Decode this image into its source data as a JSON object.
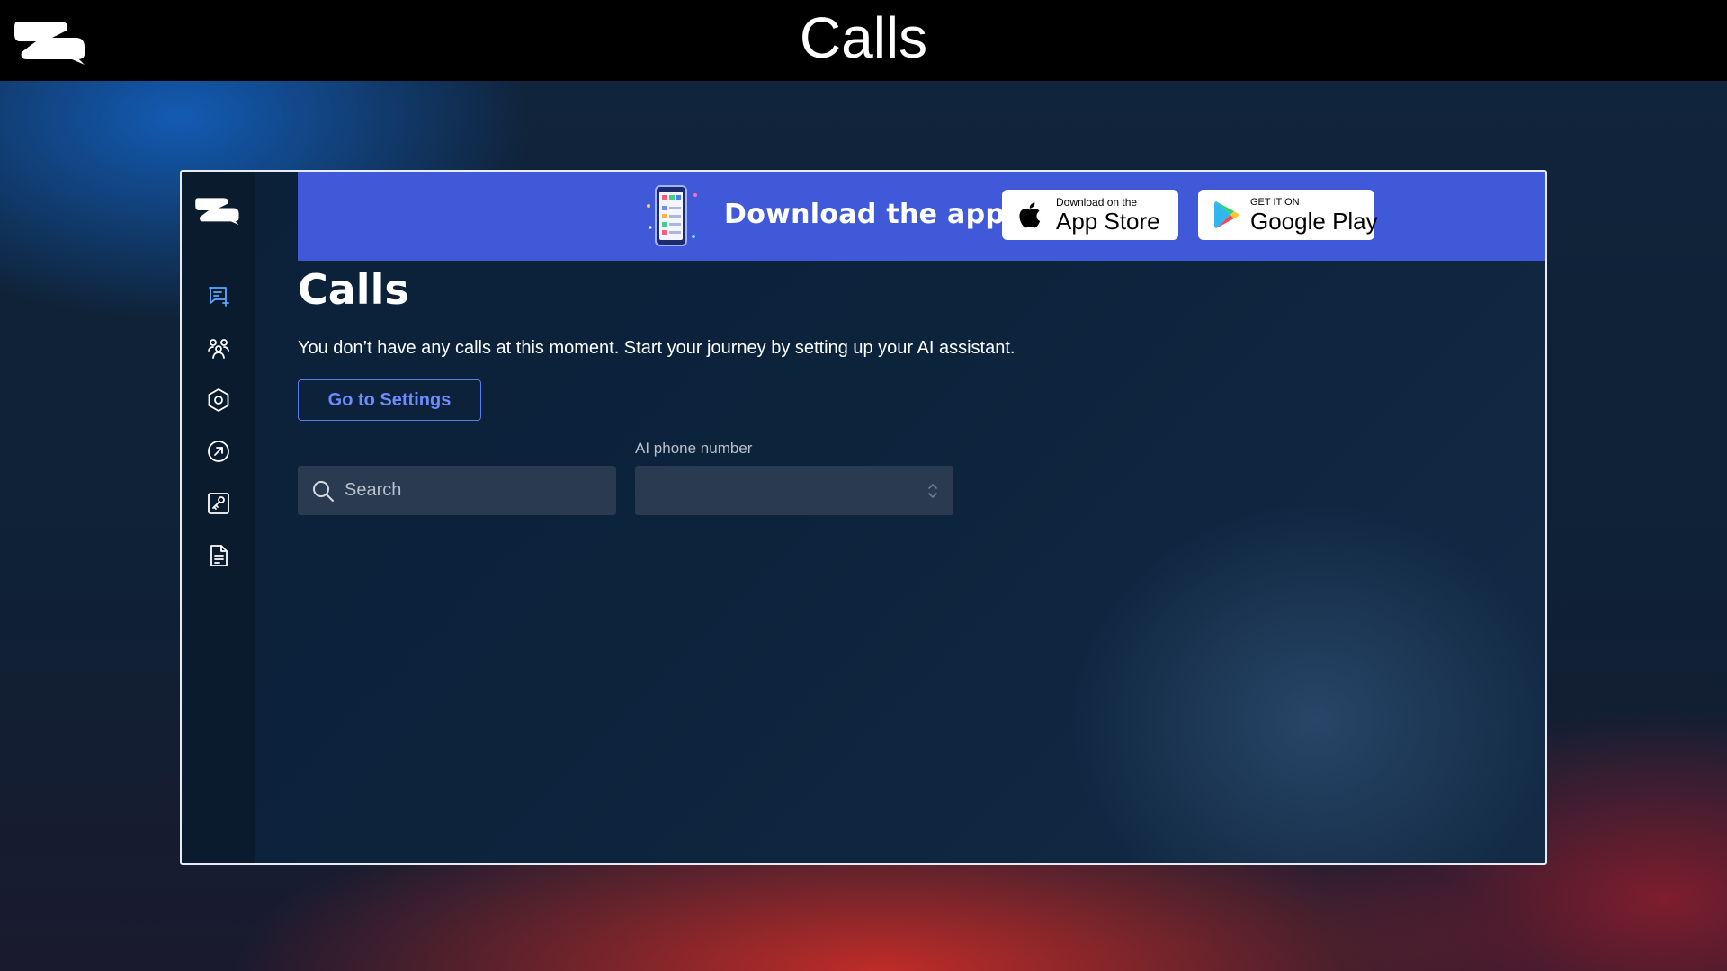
{
  "header": {
    "title": "Calls"
  },
  "sidebar": {
    "items": [
      {
        "icon": "chat-plus-icon",
        "label": "new-chat"
      },
      {
        "icon": "users-icon",
        "label": "contacts"
      },
      {
        "icon": "hexagon-settings-icon",
        "label": "settings"
      },
      {
        "icon": "arrow-circle-icon",
        "label": "explore"
      },
      {
        "icon": "key-icon",
        "label": "keys"
      },
      {
        "icon": "document-icon",
        "label": "documents"
      }
    ]
  },
  "banner": {
    "text": "Download the app",
    "app_store": {
      "small": "Download on the",
      "big": "App Store"
    },
    "google_play": {
      "small": "GET IT ON",
      "big": "Google Play"
    }
  },
  "main": {
    "title": "Calls",
    "empty_message": "You don’t have any calls at this moment. Start your journey by setting up your AI assistant.",
    "settings_button": "Go to Settings",
    "search": {
      "placeholder": "Search",
      "value": ""
    },
    "phone_select": {
      "label": "AI phone number",
      "value": ""
    }
  },
  "colors": {
    "banner": "#3f59d9",
    "accent": "#5b7cf0",
    "input_bg": "#2a3a50",
    "topbar": "#000000"
  }
}
